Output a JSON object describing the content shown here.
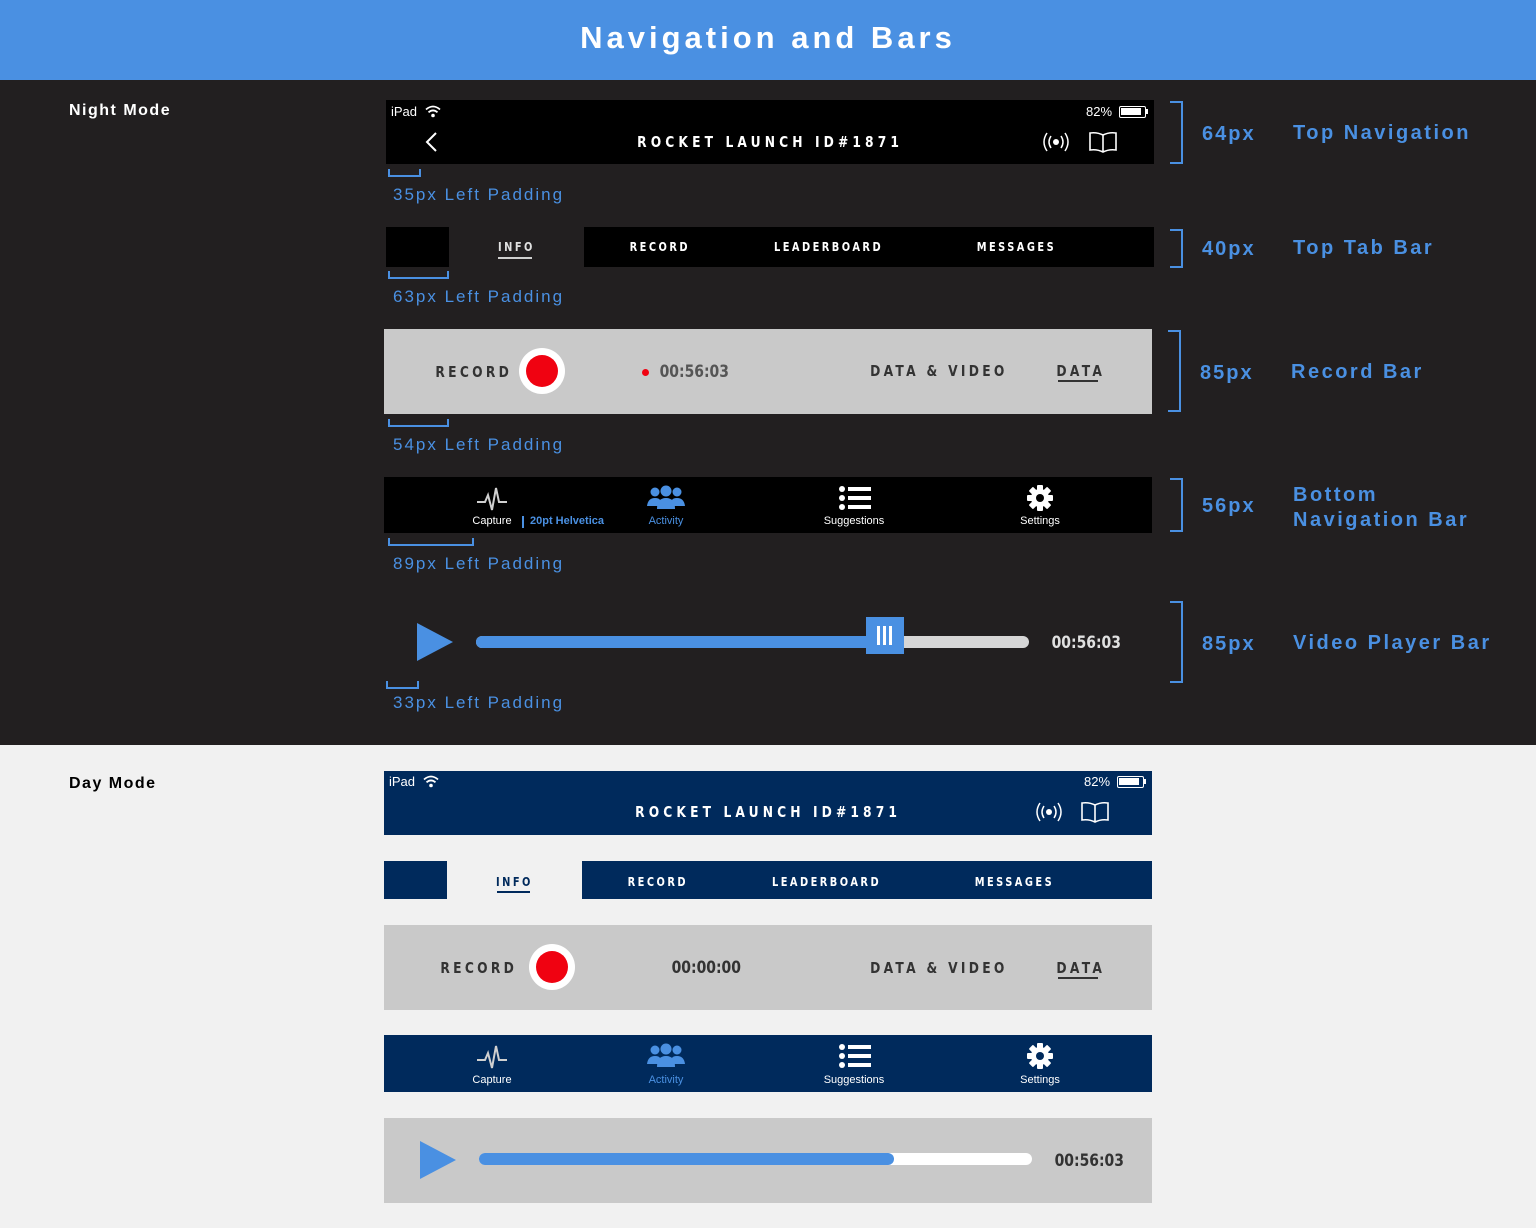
{
  "header": {
    "title": "Navigation and Bars"
  },
  "night": {
    "label": "Night Mode",
    "top_nav": {
      "device": "iPad",
      "battery": "82%",
      "title": "ROCKET LAUNCH ID#1871",
      "back_icon": "chevron-left-icon",
      "icons": [
        "broadcast-icon",
        "book-icon"
      ]
    },
    "tabs": [
      "INFO",
      "RECORD",
      "LEADERBOARD",
      "MESSAGES"
    ],
    "record_bar": {
      "record_label": "RECORD",
      "timer": "00:56:03",
      "data_video": "DATA & VIDEO",
      "data": "DATA"
    },
    "bottom_nav": {
      "items": [
        "Capture",
        "Activity",
        "Suggestions",
        "Settings"
      ],
      "note": "20pt Helvetica"
    },
    "player": {
      "time": "00:56:03",
      "progress": 0.74
    }
  },
  "annotations": [
    {
      "size": "64px",
      "name": "Top Navigation",
      "padding": "35px Left Padding"
    },
    {
      "size": "40px",
      "name": "Top Tab Bar",
      "padding": "63px Left Padding"
    },
    {
      "size": "85px",
      "name": "Record Bar",
      "padding": "54px Left Padding"
    },
    {
      "size": "56px",
      "name": "Bottom Navigation Bar",
      "padding": "89px Left Padding"
    },
    {
      "size": "85px",
      "name": "Video Player Bar",
      "padding": "33px Left Padding"
    }
  ],
  "day": {
    "label": "Day Mode",
    "top_nav": {
      "device": "iPad",
      "battery": "82%",
      "title": "ROCKET LAUNCH ID#1871",
      "icons": [
        "broadcast-icon",
        "book-icon"
      ]
    },
    "tabs": [
      "INFO",
      "RECORD",
      "LEADERBOARD",
      "MESSAGES"
    ],
    "record_bar": {
      "record_label": "RECORD",
      "timer": "00:00:00",
      "data_video": "DATA & VIDEO",
      "data": "DATA"
    },
    "bottom_nav": {
      "items": [
        "Capture",
        "Activity",
        "Suggestions",
        "Settings"
      ]
    },
    "player": {
      "time": "00:56:03",
      "progress": 0.75
    }
  },
  "colors": {
    "accent": "#4a90e2",
    "night_bg": "#221f20",
    "day_navy": "#002a5c",
    "record_red": "#f00211",
    "bar_gray": "#c8c8c8"
  }
}
